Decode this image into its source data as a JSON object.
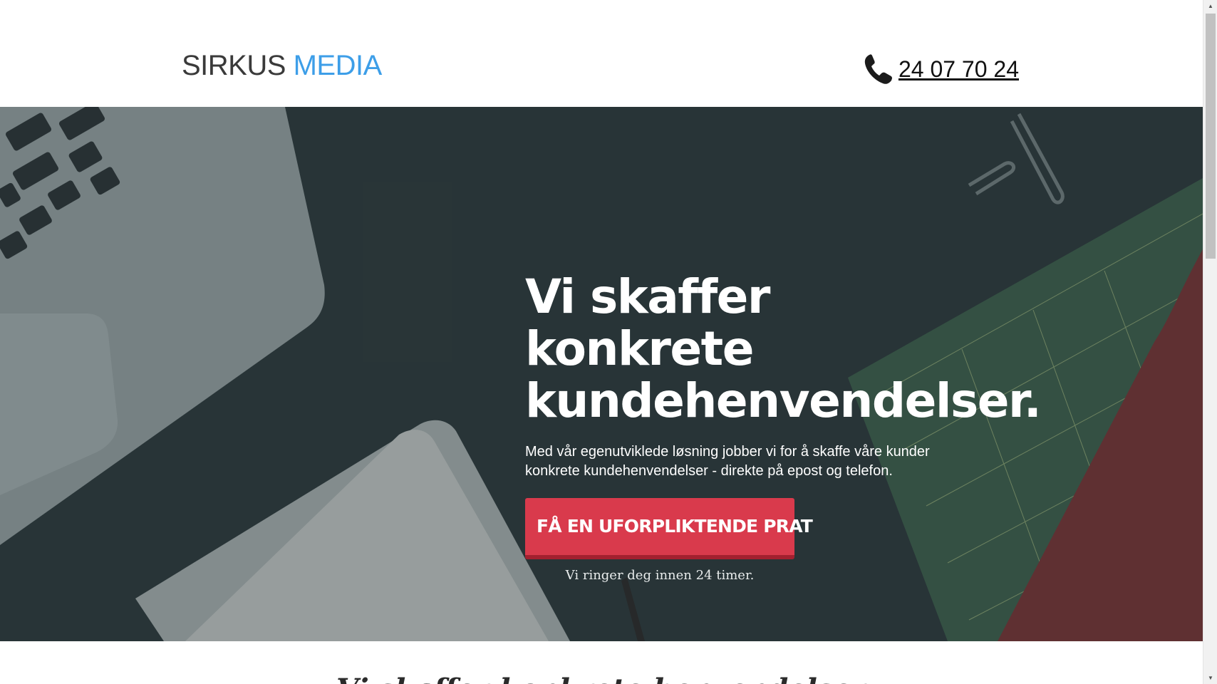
{
  "header": {
    "logo_part1": "SIRKUS",
    "logo_part2": "MEDIA",
    "phone_number": "24 07 70 24",
    "phone_icon": "phone-icon"
  },
  "hero": {
    "headline_line1": "Vi skaffer konkrete",
    "headline_line2": "kundehenvendelser.",
    "subtext": "Med vår egenutviklede løsning jobber vi for å skaffe våre kunder konkrete kundehenvendelser - direkte på epost og telefon.",
    "cta_label": "FÅ EN UFORPLIKTENDE PRAT",
    "cta_note": "Vi ringer deg innen 24 timer."
  },
  "section_below": {
    "partial_title": "Vi skaffer konkrete henvendelser"
  },
  "colors": {
    "logo_dark": "#3a3a3a",
    "logo_accent": "#3d9ee8",
    "cta_background": "#d93a4c",
    "hero_background": "#2b383a"
  }
}
